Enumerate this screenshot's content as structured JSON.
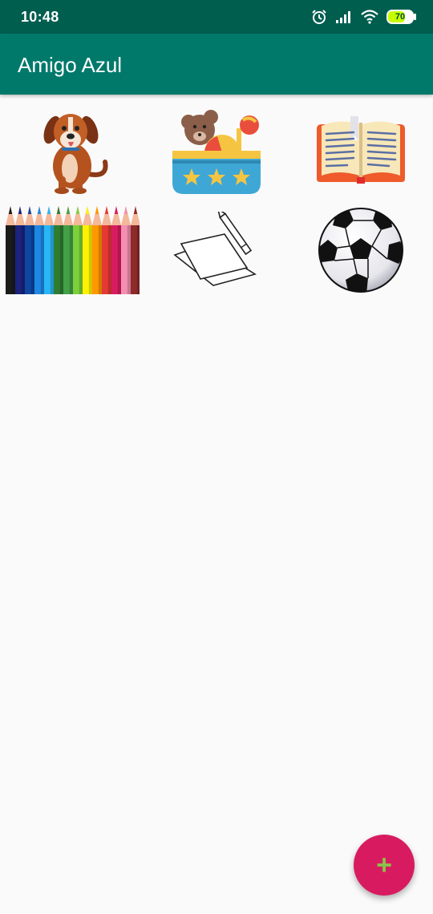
{
  "status_bar": {
    "time": "10:48",
    "battery_level": "70",
    "battery_fraction": 0.7,
    "icons": [
      "alarm-icon",
      "signal-icon",
      "wifi-icon",
      "battery-icon"
    ]
  },
  "app_bar": {
    "title": "Amigo Azul"
  },
  "grid": {
    "items": [
      {
        "icon": "dog-icon"
      },
      {
        "icon": "toy-box-icon"
      },
      {
        "icon": "open-book-icon"
      },
      {
        "icon": "colored-pencils-icon"
      },
      {
        "icon": "paper-pencil-icon"
      },
      {
        "icon": "soccer-ball-icon"
      }
    ]
  },
  "fab": {
    "label": "+",
    "icon": "add-icon"
  },
  "colors": {
    "status_bar": "#005e4f",
    "app_bar": "#00796b",
    "fab": "#d81b60",
    "fab_icon": "#8bc34a",
    "background": "#fafafa"
  }
}
